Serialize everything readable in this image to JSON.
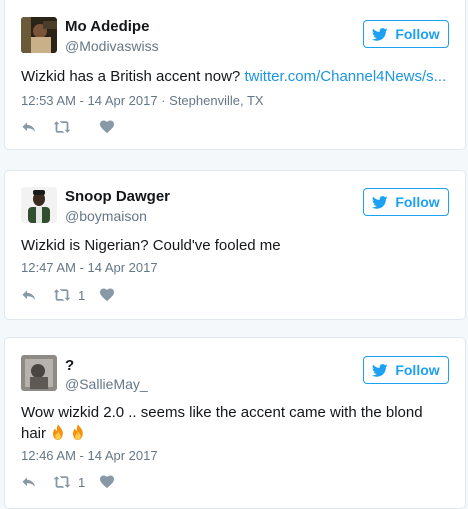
{
  "follow_label": "Follow",
  "accent_color": "#1da1f2",
  "tweets": [
    {
      "name": "Mo Adedipe",
      "handle": "@Modivaswiss",
      "text": "Wizkid has a British accent now? ",
      "link": "twitter.com/Channel4News/s...",
      "meta": "12:53 AM - 14 Apr 2017 · Stephenville, TX",
      "retweets": ""
    },
    {
      "name": "Snoop Dawger",
      "handle": "@boymaison",
      "text": "Wizkid is Nigerian? Could've fooled me",
      "meta": "12:47 AM - 14 Apr 2017",
      "retweets": "1"
    },
    {
      "name": "?",
      "handle": "@SallieMay_",
      "text": "Wow wizkid 2.0 .. seems like the accent came with the blond hair ",
      "emoji": "fire-emoji",
      "meta": "12:46 AM - 14 Apr 2017",
      "retweets": "1"
    }
  ]
}
